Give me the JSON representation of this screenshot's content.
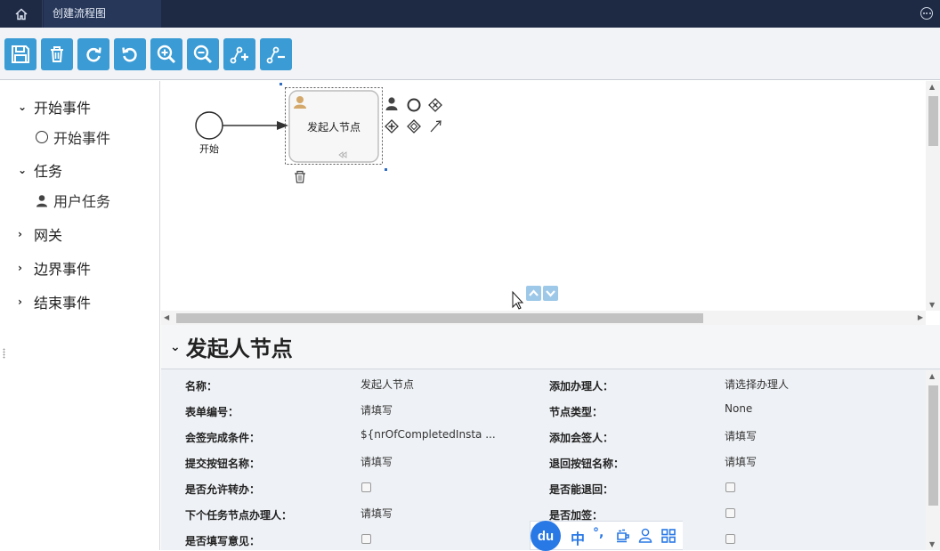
{
  "window": {
    "tab_title": "创建流程图",
    "home_icon": "home-icon",
    "more_icon": "more-circle-icon"
  },
  "toolbar": {
    "accent": "#3a9bd5",
    "buttons": [
      {
        "name": "save-button",
        "icon": "save-icon"
      },
      {
        "name": "delete-button",
        "icon": "trash-icon"
      },
      {
        "name": "redo-button",
        "icon": "redo-icon"
      },
      {
        "name": "undo-button",
        "icon": "undo-icon"
      },
      {
        "name": "zoom-in-button",
        "icon": "zoom-in-icon"
      },
      {
        "name": "zoom-out-button",
        "icon": "zoom-out-icon"
      },
      {
        "name": "add-flow-button",
        "icon": "add-connection-icon"
      },
      {
        "name": "remove-flow-button",
        "icon": "remove-connection-icon"
      }
    ]
  },
  "palette": {
    "groups": [
      {
        "label": "开始事件",
        "expanded": true,
        "items": [
          {
            "label": "开始事件",
            "icon": "circle-icon"
          }
        ]
      },
      {
        "label": "任务",
        "expanded": true,
        "items": [
          {
            "label": "用户任务",
            "icon": "user-icon"
          }
        ]
      },
      {
        "label": "网关",
        "expanded": false,
        "items": []
      },
      {
        "label": "边界事件",
        "expanded": false,
        "items": []
      },
      {
        "label": "结束事件",
        "expanded": false,
        "items": []
      }
    ]
  },
  "canvas": {
    "start_event_label": "开始",
    "task_label": "发起人节点",
    "context_pad_icons": [
      "user-icon",
      "circle-icon",
      "exclusive-gateway-icon",
      "parallel-gateway-icon",
      "gateway-icon",
      "arrow-icon",
      "trash-icon"
    ]
  },
  "properties": {
    "title": "发起人节点",
    "rows": [
      {
        "left_label": "名称：",
        "left_value": "发起人节点",
        "left_type": "text",
        "right_label": "添加办理人：",
        "right_value": "请选择办理人",
        "right_type": "text"
      },
      {
        "left_label": "表单编号：",
        "left_value": "请填写",
        "left_type": "text",
        "right_label": "节点类型：",
        "right_value": "None",
        "right_type": "text"
      },
      {
        "left_label": "会签完成条件：",
        "left_value": "${nrOfCompletedInsta ...",
        "left_type": "text",
        "right_label": "添加会签人：",
        "right_value": "请填写",
        "right_type": "text"
      },
      {
        "left_label": "提交按钮名称：",
        "left_value": "请填写",
        "left_type": "text",
        "right_label": "退回按钮名称：",
        "right_value": "请填写",
        "right_type": "text"
      },
      {
        "left_label": "是否允许转办：",
        "left_value": "",
        "left_type": "checkbox",
        "right_label": "是否能退回：",
        "right_value": "",
        "right_type": "checkbox"
      },
      {
        "left_label": "下个任务节点办理人：",
        "left_value": "请填写",
        "left_type": "text",
        "right_label": "是否加签：",
        "right_value": "",
        "right_type": "checkbox"
      },
      {
        "left_label": "是否填写意见：",
        "left_value": "",
        "left_type": "checkbox",
        "right_label": "：",
        "right_value": "",
        "right_type": "checkbox"
      }
    ]
  },
  "ime": {
    "logo": "du",
    "mode": "中",
    "punct": "°,"
  }
}
